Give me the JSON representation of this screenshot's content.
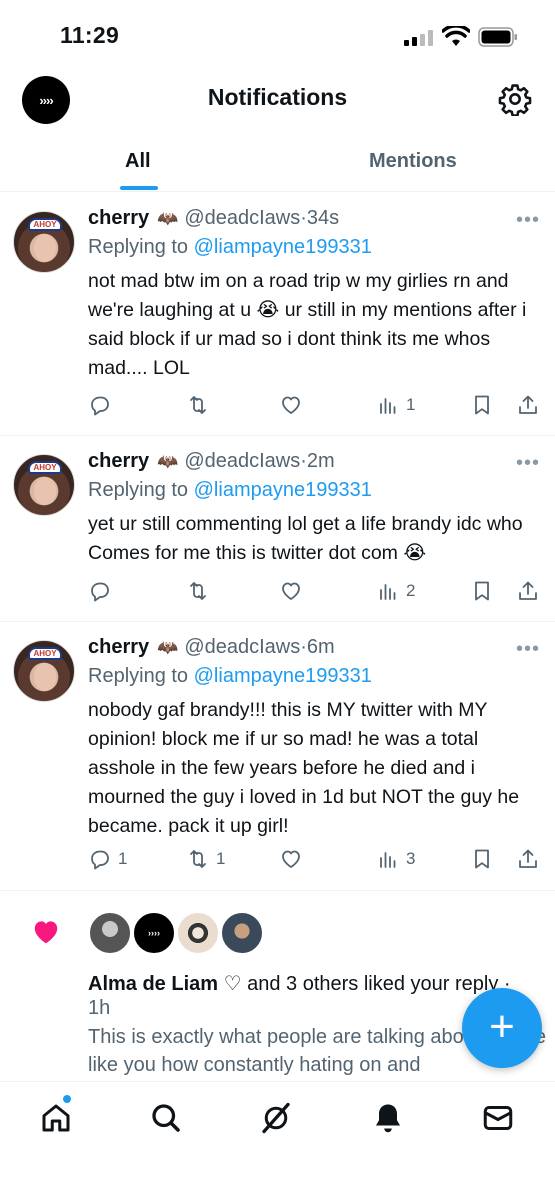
{
  "status_bar": {
    "time": "11:29"
  },
  "header": {
    "title": "Notifications",
    "avatar_text": "››››"
  },
  "tabs": [
    {
      "label": "All",
      "active": true
    },
    {
      "label": "Mentions",
      "active": false
    }
  ],
  "tweets": [
    {
      "name": "cherry",
      "handle": "@deadcIaws",
      "time": "34s",
      "replying_prefix": "Replying to",
      "replying_to": "@liampayne199331",
      "text": "not mad btw im on a road trip w my girlies rn and we're laughing at u 😭 ur still in my mentions after i said block if ur mad so i dont think its me whos mad.... LOL",
      "replies": "",
      "reposts": "",
      "views": "1"
    },
    {
      "name": "cherry",
      "handle": "@deadcIaws",
      "time": "2m",
      "replying_prefix": "Replying to",
      "replying_to": "@liampayne199331",
      "text": "yet ur still commenting lol get a life brandy idc who Comes for me this is twitter dot com 😭",
      "replies": "",
      "reposts": "",
      "views": "2"
    },
    {
      "name": "cherry",
      "handle": "@deadcIaws",
      "time": "6m",
      "replying_prefix": "Replying to",
      "replying_to": "@liampayne199331",
      "text": "nobody gaf brandy!!! this is MY twitter with MY opinion! block me if ur so mad! he was a total asshole in the few years before he died and i mourned the guy i loved in 1d but NOT the guy he became.  pack it up girl!",
      "replies": "1",
      "reposts": "1",
      "views": "3"
    }
  ],
  "like_notification": {
    "actor": "Alma de Liam ♡",
    "action": " and 3 others liked your reply ·",
    "time": "1h",
    "preview": "This is exactly what people are talking about people like you how constantly hating on and"
  },
  "fab_label": "+",
  "colors": {
    "accent": "#1d9bf0",
    "like": "#f91880",
    "muted": "#536471"
  },
  "bottom_nav": [
    "home-icon",
    "search-icon",
    "grok-icon",
    "bell-icon",
    "mail-icon"
  ]
}
